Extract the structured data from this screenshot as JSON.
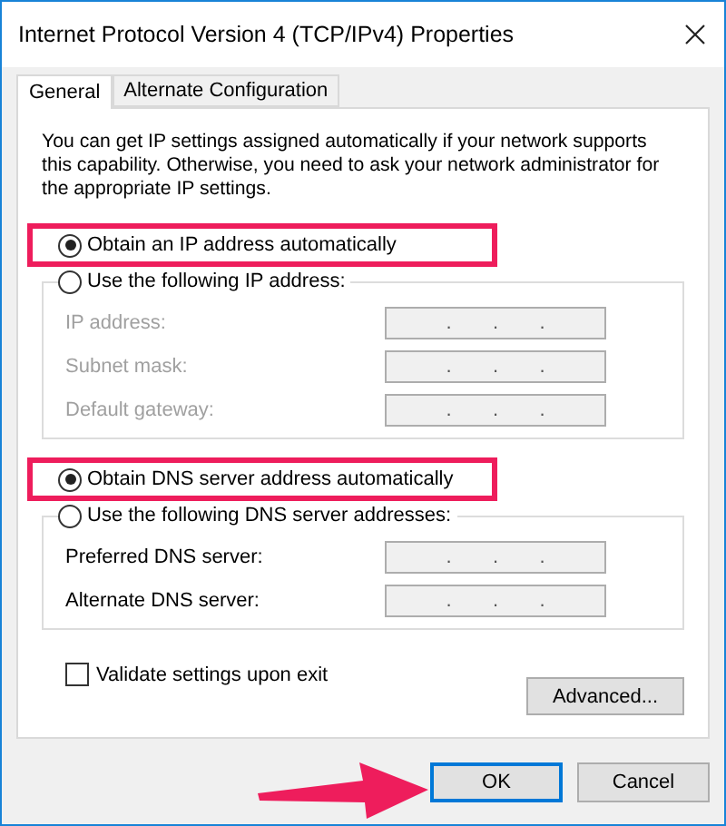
{
  "window": {
    "title": "Internet Protocol Version 4 (TCP/IPv4) Properties"
  },
  "tabs": [
    {
      "label": "General",
      "selected": true
    },
    {
      "label": "Alternate Configuration",
      "selected": false
    }
  ],
  "intro": "You can get IP settings assigned automatically if your network supports this capability. Otherwise, you need to ask your network administrator for the appropriate IP settings.",
  "sections": [
    {
      "auto_option": {
        "label": "Obtain an IP address automatically",
        "selected": true,
        "highlighted": true
      },
      "manual_option": {
        "label": "Use the following IP address:",
        "selected": false
      },
      "fields": [
        {
          "label": "IP address:",
          "disabled": true,
          "separators": [
            ".",
            ".",
            "."
          ]
        },
        {
          "label": "Subnet mask:",
          "disabled": true,
          "separators": [
            ".",
            ".",
            "."
          ]
        },
        {
          "label": "Default gateway:",
          "disabled": true,
          "separators": [
            ".",
            ".",
            "."
          ]
        }
      ]
    },
    {
      "auto_option": {
        "label": "Obtain DNS server address automatically",
        "selected": true,
        "highlighted": true
      },
      "manual_option": {
        "label": "Use the following DNS server addresses:",
        "selected": false
      },
      "fields": [
        {
          "label": "Preferred DNS server:",
          "disabled": false,
          "separators": [
            ".",
            ".",
            "."
          ]
        },
        {
          "label": "Alternate DNS server:",
          "disabled": false,
          "separators": [
            ".",
            ".",
            "."
          ]
        }
      ]
    }
  ],
  "validate": {
    "label": "Validate settings upon exit",
    "checked": false
  },
  "advanced_button": "Advanced...",
  "buttons": [
    {
      "label": "OK",
      "focused": true
    },
    {
      "label": "Cancel",
      "focused": false
    }
  ],
  "annotation_arrow": true
}
